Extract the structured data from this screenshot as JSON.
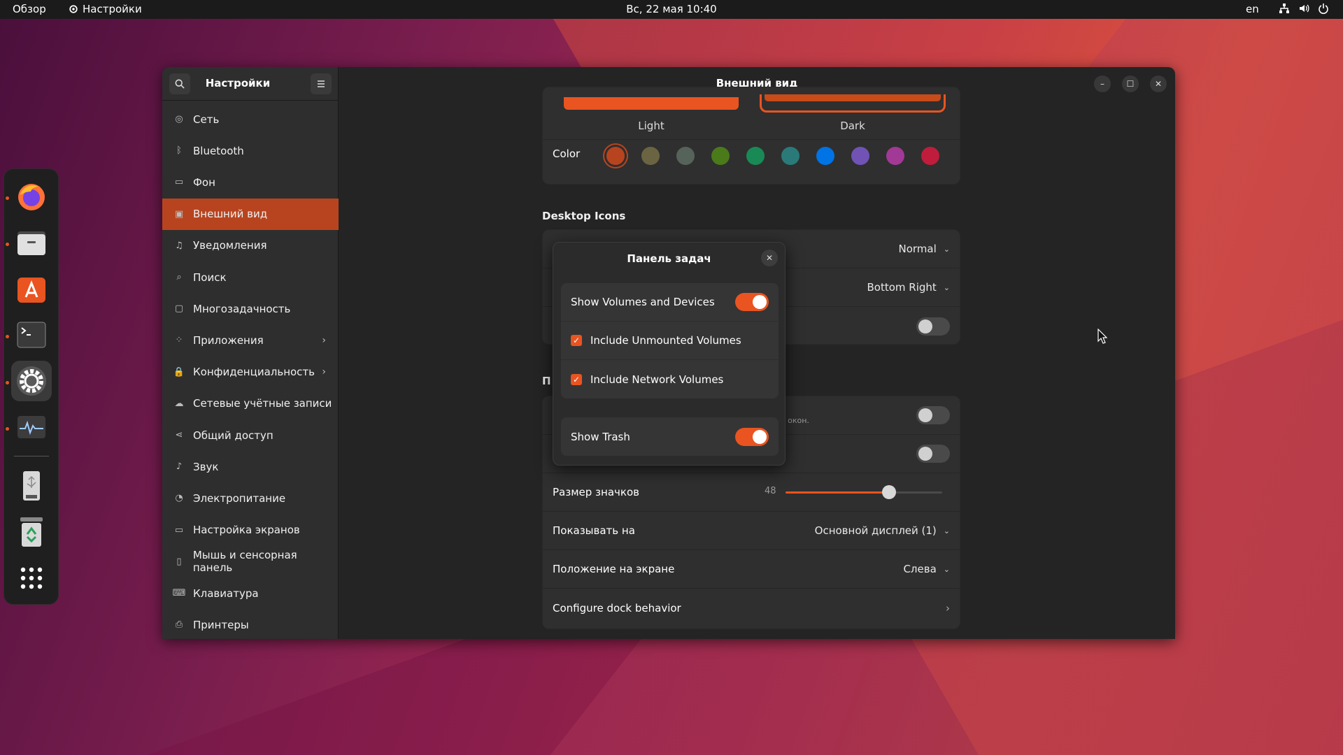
{
  "topbar": {
    "overview": "Обзор",
    "app_name": "Настройки",
    "clock": "Вс, 22 мая  10:40",
    "lang": "en"
  },
  "dock": {
    "items": [
      {
        "name": "firefox-icon",
        "running": true
      },
      {
        "name": "files-icon",
        "running": true
      },
      {
        "name": "app-center-icon",
        "running": false
      },
      {
        "name": "terminal-icon",
        "running": true
      },
      {
        "name": "settings-icon",
        "running": true,
        "active": true
      },
      {
        "name": "system-monitor-icon",
        "running": true
      },
      {
        "name": "usb-drive-icon",
        "running": false
      },
      {
        "name": "trash-icon",
        "running": false
      },
      {
        "name": "show-apps-icon",
        "running": false
      }
    ]
  },
  "window": {
    "sidebar_title": "Настройки",
    "title": "Внешний вид"
  },
  "sidebar": {
    "items": [
      {
        "label": "Сеть",
        "icon": "network-icon"
      },
      {
        "label": "Bluetooth",
        "icon": "bluetooth-icon"
      },
      {
        "label": "Фон",
        "icon": "background-icon"
      },
      {
        "label": "Внешний вид",
        "icon": "appearance-icon",
        "selected": true
      },
      {
        "label": "Уведомления",
        "icon": "bell-icon"
      },
      {
        "label": "Поиск",
        "icon": "search-icon"
      },
      {
        "label": "Многозадачность",
        "icon": "multitasking-icon"
      },
      {
        "label": "Приложения",
        "icon": "apps-icon",
        "chevron": true
      },
      {
        "label": "Конфиденциальность",
        "icon": "lock-icon",
        "chevron": true
      },
      {
        "label": "Сетевые учётные записи",
        "icon": "cloud-icon"
      },
      {
        "label": "Общий доступ",
        "icon": "share-icon"
      },
      {
        "label": "Звук",
        "icon": "music-note-icon"
      },
      {
        "label": "Электропитание",
        "icon": "power-icon"
      },
      {
        "label": "Настройка экранов",
        "icon": "display-icon"
      },
      {
        "label": "Мышь и сенсорная панель",
        "icon": "mouse-icon"
      },
      {
        "label": "Клавиатура",
        "icon": "keyboard-icon"
      },
      {
        "label": "Принтеры",
        "icon": "printer-icon"
      }
    ]
  },
  "appearance": {
    "style_light": "Light",
    "style_dark": "Dark",
    "color_label": "Color",
    "colors": [
      "#b8441f",
      "#6b6442",
      "#56635a",
      "#4a7a1a",
      "#198a55",
      "#2a7a7a",
      "#0073e5",
      "#7053b5",
      "#a23996",
      "#c01c3c"
    ],
    "selected_color": 0,
    "desktop_icons_title": "Desktop Icons",
    "icon_size_value": "Normal",
    "new_icons_position": "Bottom Right",
    "show_personal_folder": false
  },
  "dock_settings": {
    "partial_title": "П",
    "partial_hint": "к окон.",
    "toggle1": false,
    "toggle2": false,
    "icon_size_label": "Размер значков",
    "icon_size_value": "48",
    "icon_size_fraction": 0.66,
    "show_on_label": "Показывать на",
    "show_on_value": "Основной дисплей (1)",
    "position_label": "Положение на экране",
    "position_value": "Слева",
    "configure_label": "Configure dock behavior"
  },
  "dialog": {
    "title": "Панель задач",
    "show_volumes": "Show Volumes and Devices",
    "show_volumes_on": true,
    "include_unmounted": "Include Unmounted Volumes",
    "include_unmounted_checked": true,
    "include_network": "Include Network Volumes",
    "include_network_checked": true,
    "show_trash": "Show Trash",
    "show_trash_on": true
  },
  "accent": "#e95420"
}
